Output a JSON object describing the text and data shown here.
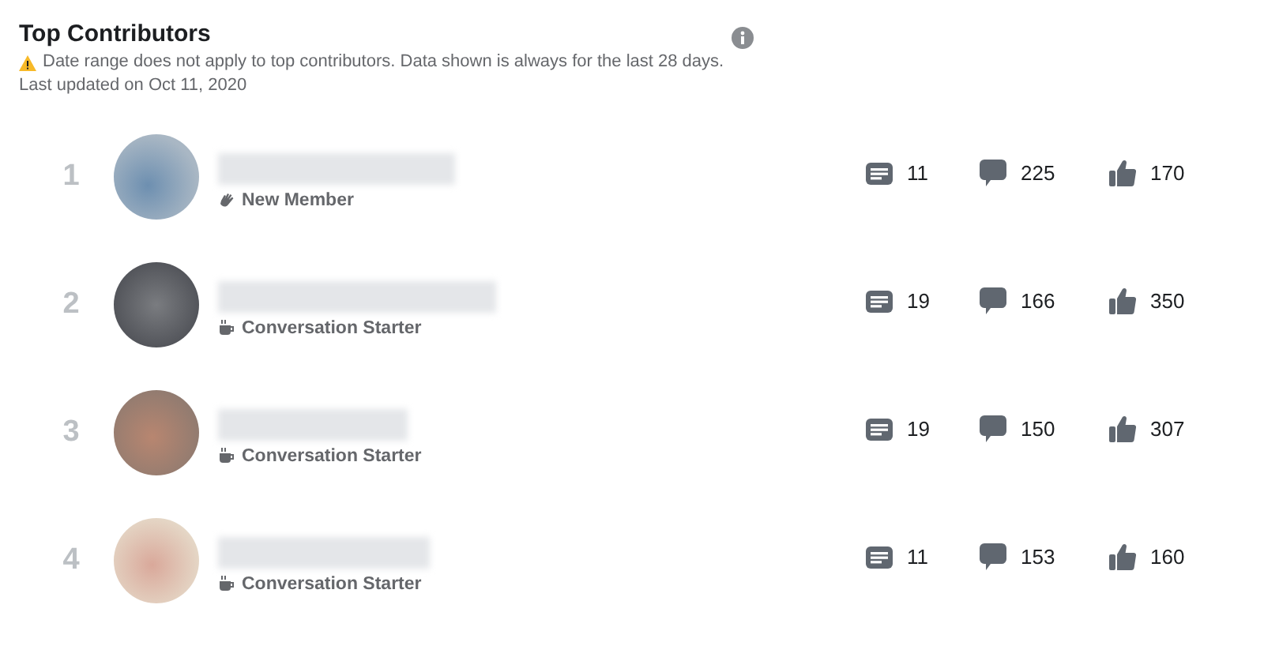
{
  "header": {
    "title": "Top Contributors",
    "notice": "Date range does not apply to top contributors. Data shown is always for the last 28 days.",
    "updated": "Last updated on Oct 11, 2020"
  },
  "contributors": [
    {
      "rank": "1",
      "badge": {
        "kind": "new_member",
        "label": "New Member"
      },
      "posts": "11",
      "comments": "225",
      "reactions": "170"
    },
    {
      "rank": "2",
      "badge": {
        "kind": "conversation_starter",
        "label": "Conversation Starter"
      },
      "posts": "19",
      "comments": "166",
      "reactions": "350"
    },
    {
      "rank": "3",
      "badge": {
        "kind": "conversation_starter",
        "label": "Conversation Starter"
      },
      "posts": "19",
      "comments": "150",
      "reactions": "307"
    },
    {
      "rank": "4",
      "badge": {
        "kind": "conversation_starter",
        "label": "Conversation Starter"
      },
      "posts": "11",
      "comments": "153",
      "reactions": "160"
    }
  ]
}
